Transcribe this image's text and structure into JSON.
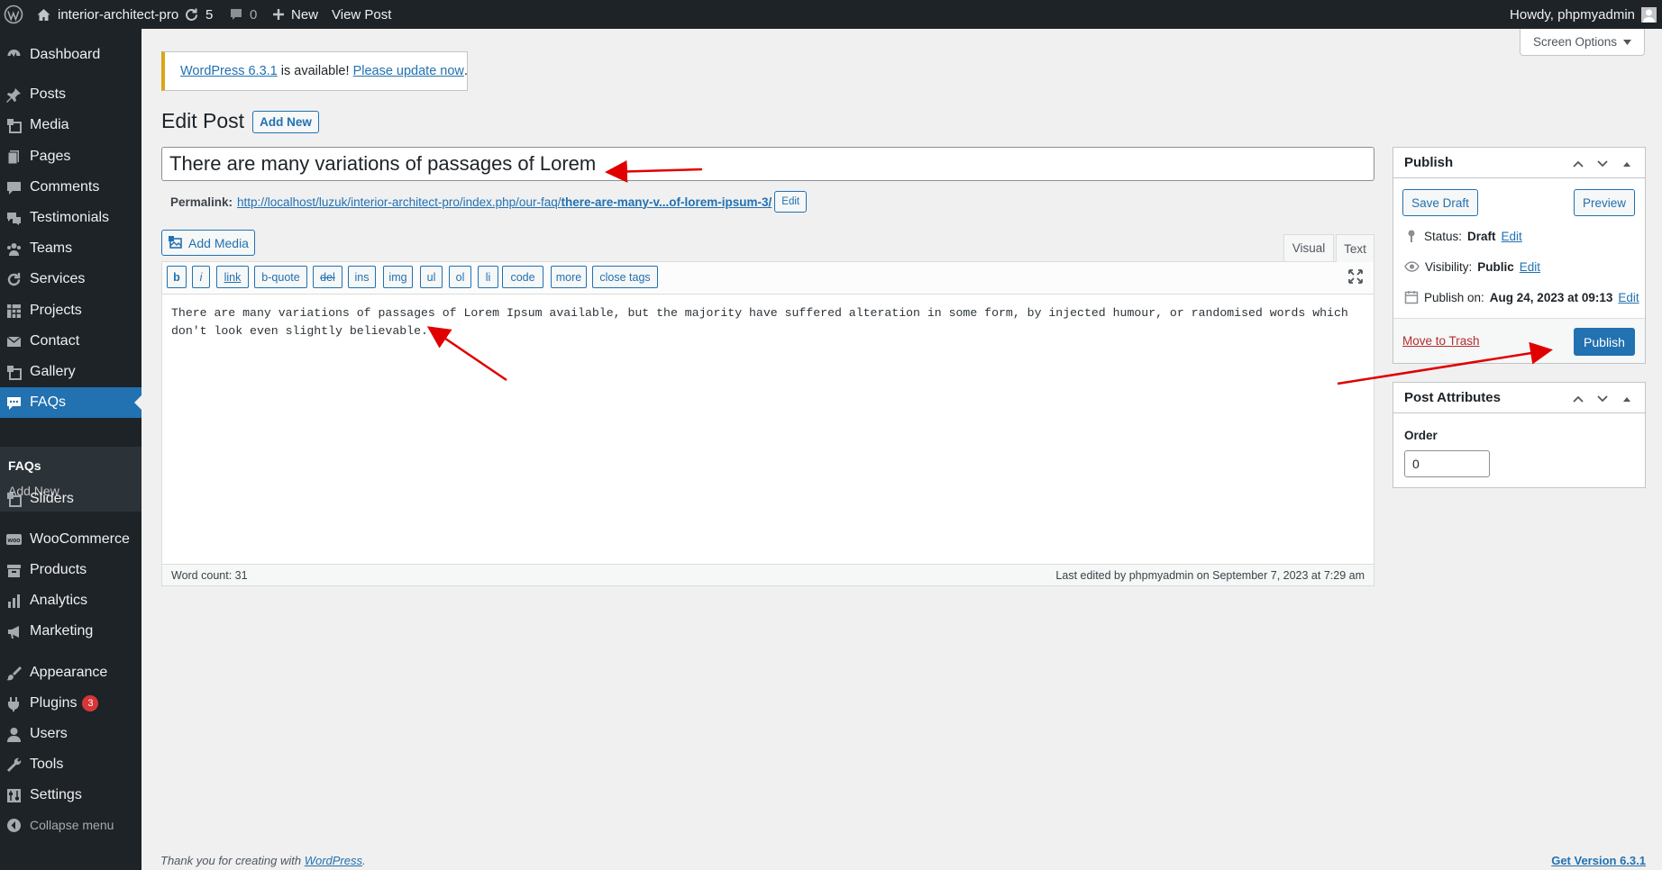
{
  "adminbar": {
    "site_name": "interior-architect-pro",
    "updates_count": "5",
    "comments_count": "0",
    "new_label": "New",
    "view_post_label": "View Post",
    "howdy": "Howdy, phpmyadmin"
  },
  "sidebar": {
    "items": [
      {
        "label": "Dashboard",
        "icon": "dashboard-icon"
      },
      {
        "label": "Posts",
        "icon": "pin-icon"
      },
      {
        "label": "Media",
        "icon": "media-icon"
      },
      {
        "label": "Pages",
        "icon": "pages-icon"
      },
      {
        "label": "Comments",
        "icon": "comment-icon"
      },
      {
        "label": "Testimonials",
        "icon": "testimonial-icon"
      },
      {
        "label": "Teams",
        "icon": "groups-icon"
      },
      {
        "label": "Services",
        "icon": "update-icon"
      },
      {
        "label": "Projects",
        "icon": "grid-icon"
      },
      {
        "label": "Contact",
        "icon": "email-icon"
      },
      {
        "label": "Gallery",
        "icon": "gallery-icon"
      },
      {
        "label": "FAQs",
        "icon": "faq-icon"
      },
      {
        "label": "Sliders",
        "icon": "slides-icon"
      },
      {
        "label": "WooCommerce",
        "icon": "woo-icon"
      },
      {
        "label": "Products",
        "icon": "archive-icon"
      },
      {
        "label": "Analytics",
        "icon": "bar-chart-icon"
      },
      {
        "label": "Marketing",
        "icon": "megaphone-icon"
      },
      {
        "label": "Appearance",
        "icon": "brush-icon"
      },
      {
        "label": "Plugins",
        "icon": "plugin-icon"
      },
      {
        "label": "Users",
        "icon": "users-icon"
      },
      {
        "label": "Tools",
        "icon": "wrench-icon"
      },
      {
        "label": "Settings",
        "icon": "settings-icon"
      },
      {
        "label": "Collapse menu",
        "icon": "collapse-icon"
      }
    ],
    "submenu": [
      "FAQs",
      "Add New"
    ],
    "plugins_badge": "3"
  },
  "notice": {
    "link1": "WordPress 6.3.1",
    "text": " is available! ",
    "link2": "Please update now",
    "end": "."
  },
  "screen_options": "Screen Options",
  "page": {
    "title": "Edit Post",
    "add_new": "Add New"
  },
  "post": {
    "title": "There are many variations of passages of Lorem",
    "permalink_label": "Permalink:",
    "permalink_base": "http://localhost/luzuk/interior-architect-pro/index.php/our-faq/",
    "permalink_slug": "there-are-many-v...of-lorem-ipsum-3/",
    "permalink_edit": "Edit",
    "content": "There are many variations of passages of Lorem Ipsum available, but the majority have suffered alteration in some form, by injected humour, or randomised words which don't look even slightly believable."
  },
  "editor": {
    "add_media": "Add Media",
    "tab_visual": "Visual",
    "tab_text": "Text",
    "quicktags": [
      "b",
      "i",
      "link",
      "b-quote",
      "del",
      "ins",
      "img",
      "ul",
      "ol",
      "li",
      "code",
      "more",
      "close tags"
    ],
    "word_count": "Word count: 31",
    "last_edited": "Last edited by phpmyadmin on September 7, 2023 at 7:29 am"
  },
  "publish": {
    "title": "Publish",
    "save_draft": "Save Draft",
    "preview": "Preview",
    "status_label": "Status:",
    "status_value": "Draft",
    "visibility_label": "Visibility:",
    "visibility_value": "Public",
    "publish_on_label": "Publish on:",
    "publish_on_value": "Aug 24, 2023 at 09:13",
    "edit": "Edit",
    "trash": "Move to Trash",
    "publish_btn": "Publish"
  },
  "attributes": {
    "title": "Post Attributes",
    "order_label": "Order",
    "order_value": "0"
  },
  "footer": {
    "thanks": "Thank you for creating with ",
    "wp_link": "WordPress",
    "period": ".",
    "version": "Get Version 6.3.1"
  },
  "colors": {
    "accent": "#2271b1",
    "annotation": "#e00000",
    "sidebar": "#1d2327"
  }
}
